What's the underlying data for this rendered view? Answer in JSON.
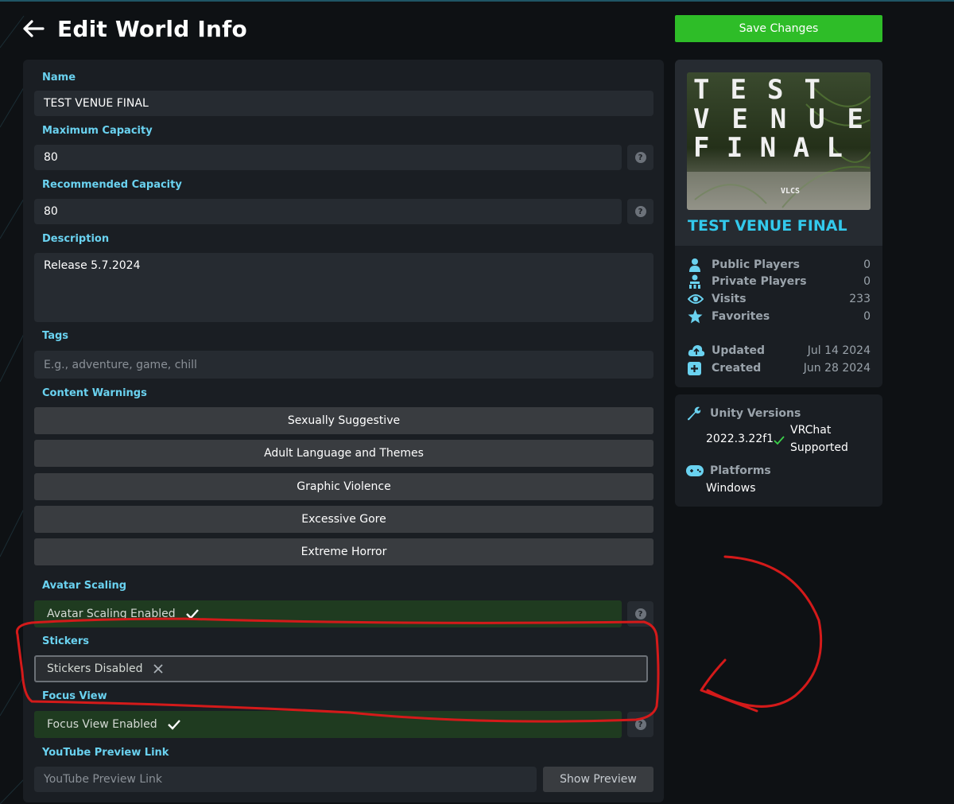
{
  "header": {
    "title": "Edit World Info",
    "save_label": "Save Changes"
  },
  "form": {
    "name": {
      "label": "Name",
      "value": "TEST VENUE FINAL"
    },
    "max_capacity": {
      "label": "Maximum Capacity",
      "value": "80"
    },
    "rec_capacity": {
      "label": "Recommended Capacity",
      "value": "80"
    },
    "description": {
      "label": "Description",
      "value": "Release 5.7.2024"
    },
    "tags": {
      "label": "Tags",
      "placeholder": "E.g., adventure, game, chill"
    },
    "content_warnings": {
      "label": "Content Warnings",
      "items": [
        "Sexually Suggestive",
        "Adult Language and Themes",
        "Graphic Violence",
        "Excessive Gore",
        "Extreme Horror"
      ]
    },
    "avatar_scaling": {
      "label": "Avatar Scaling",
      "value": "Avatar Scaling Enabled"
    },
    "stickers": {
      "label": "Stickers",
      "value": "Stickers Disabled"
    },
    "focus_view": {
      "label": "Focus View",
      "value": "Focus View Enabled"
    },
    "youtube": {
      "label": "YouTube Preview Link",
      "placeholder": "YouTube Preview Link",
      "button": "Show Preview"
    },
    "help_glyph": "?"
  },
  "world_card": {
    "thumbnail_text": [
      "TEST",
      "VENUE",
      "FINAL"
    ],
    "thumbnail_tag": "VLCS",
    "name": "TEST VENUE FINAL",
    "stats": [
      {
        "icon": "person-icon",
        "label": "Public Players",
        "value": "0"
      },
      {
        "icon": "private-group-icon",
        "label": "Private Players",
        "value": "0"
      },
      {
        "icon": "eye-icon",
        "label": "Visits",
        "value": "233"
      },
      {
        "icon": "star-icon",
        "label": "Favorites",
        "value": "0"
      }
    ],
    "dates": [
      {
        "icon": "cloud-upload-icon",
        "label": "Updated",
        "value": "Jul 14 2024"
      },
      {
        "icon": "plus-square-icon",
        "label": "Created",
        "value": "Jun 28 2024"
      }
    ]
  },
  "unity_card": {
    "versions_label": "Unity Versions",
    "version": "2022.3.22f1",
    "support_line1": "VRChat",
    "support_line2": "Supported",
    "platforms_label": "Platforms",
    "platform": "Windows"
  },
  "colors": {
    "accent": "#6ad2f0",
    "world_name": "#33c9ec",
    "save_green": "#2ebd28",
    "toggle_on": "#1f3b20",
    "annotation_red": "#d41a1a"
  }
}
